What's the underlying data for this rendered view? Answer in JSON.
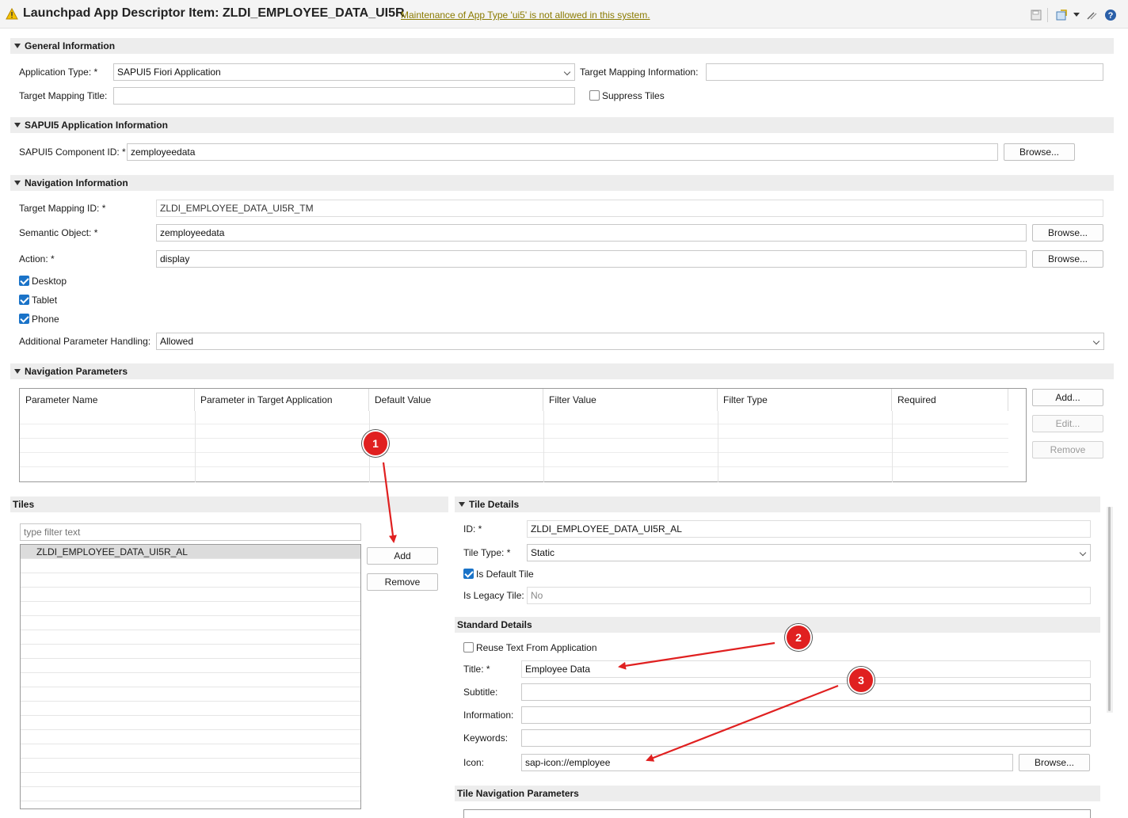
{
  "header": {
    "title": "Launchpad App Descriptor Item: ZLDI_EMPLOYEE_DATA_UI5R",
    "warning_link": "Maintenance of App Type 'ui5' is not allowed in this system."
  },
  "general": {
    "section": "General Information",
    "app_type_label": "Application Type: *",
    "app_type_value": "SAPUI5 Fiori Application",
    "tm_info_label": "Target Mapping Information:",
    "tm_info_value": "",
    "tm_title_label": "Target Mapping Title:",
    "tm_title_value": "",
    "suppress_tiles": "Suppress Tiles"
  },
  "sapui5": {
    "section": "SAPUI5 Application Information",
    "component_label": "SAPUI5 Component ID: *",
    "component_value": "zemployeedata",
    "browse": "Browse..."
  },
  "navigation": {
    "section": "Navigation Information",
    "tm_id_label": "Target Mapping ID: *",
    "tm_id_value": "ZLDI_EMPLOYEE_DATA_UI5R_TM",
    "semantic_label": "Semantic Object: *",
    "semantic_value": "zemployeedata",
    "action_label": "Action: *",
    "action_value": "display",
    "browse": "Browse...",
    "desktop": "Desktop",
    "tablet": "Tablet",
    "phone": "Phone",
    "param_handling_label": "Additional Parameter Handling:",
    "param_handling_value": "Allowed"
  },
  "nav_params": {
    "section": "Navigation Parameters",
    "columns": [
      "Parameter Name",
      "Parameter in Target Application",
      "Default Value",
      "Filter Value",
      "Filter Type",
      "Required"
    ],
    "add": "Add...",
    "edit": "Edit...",
    "remove": "Remove"
  },
  "tiles": {
    "section": "Tiles",
    "filter_placeholder": "type filter text",
    "items": [
      "ZLDI_EMPLOYEE_DATA_UI5R_AL"
    ],
    "add": "Add",
    "remove": "Remove"
  },
  "tile_details": {
    "section": "Tile Details",
    "id_label": "ID: *",
    "id_value": "ZLDI_EMPLOYEE_DATA_UI5R_AL",
    "type_label": "Tile Type: *",
    "type_value": "Static",
    "default_tile": "Is Default Tile",
    "legacy_label": "Is Legacy Tile:",
    "legacy_value": "No"
  },
  "standard_details": {
    "section": "Standard Details",
    "reuse_text": "Reuse Text From Application",
    "title_label": "Title: *",
    "title_value": "Employee Data",
    "subtitle_label": "Subtitle:",
    "subtitle_value": "",
    "information_label": "Information:",
    "information_value": "",
    "keywords_label": "Keywords:",
    "keywords_value": "",
    "icon_label": "Icon:",
    "icon_value": "sap-icon://employee",
    "browse": "Browse..."
  },
  "tile_nav_params": {
    "section": "Tile Navigation Parameters"
  },
  "annotations": {
    "badge1": "1",
    "badge2": "2",
    "badge3": "3",
    "color": "#e02020"
  },
  "icons": [
    "warning-icon",
    "save-icon",
    "export-icon",
    "edit-icon",
    "help-icon"
  ]
}
